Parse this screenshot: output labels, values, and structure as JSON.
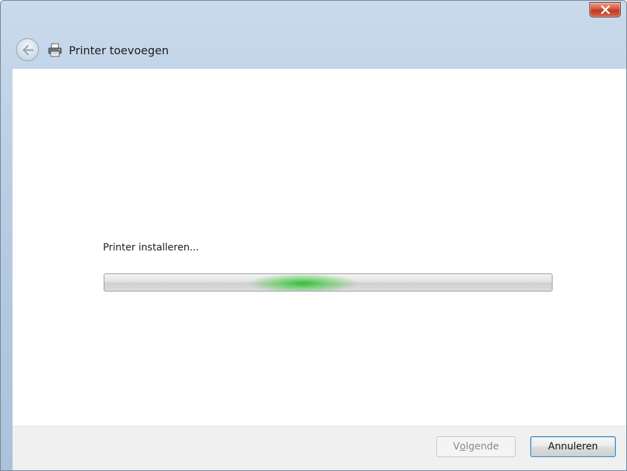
{
  "window": {
    "title": "Printer toevoegen",
    "close_icon": "close-icon"
  },
  "nav": {
    "back_icon": "back-arrow-icon",
    "app_icon": "printer-icon"
  },
  "main": {
    "status_text": "Printer installeren...",
    "progress": {
      "mode": "indeterminate",
      "accent": "#2dbf2d"
    }
  },
  "footer": {
    "next_button": {
      "label_before": "V",
      "label_accel": "o",
      "label_after": "lgende",
      "enabled": false
    },
    "cancel_button": {
      "label": "Annuleren",
      "enabled": true
    }
  },
  "colors": {
    "titlebar": "#b9cde3",
    "close_button": "#d0472e",
    "footer_bg": "#f0f0f0"
  }
}
